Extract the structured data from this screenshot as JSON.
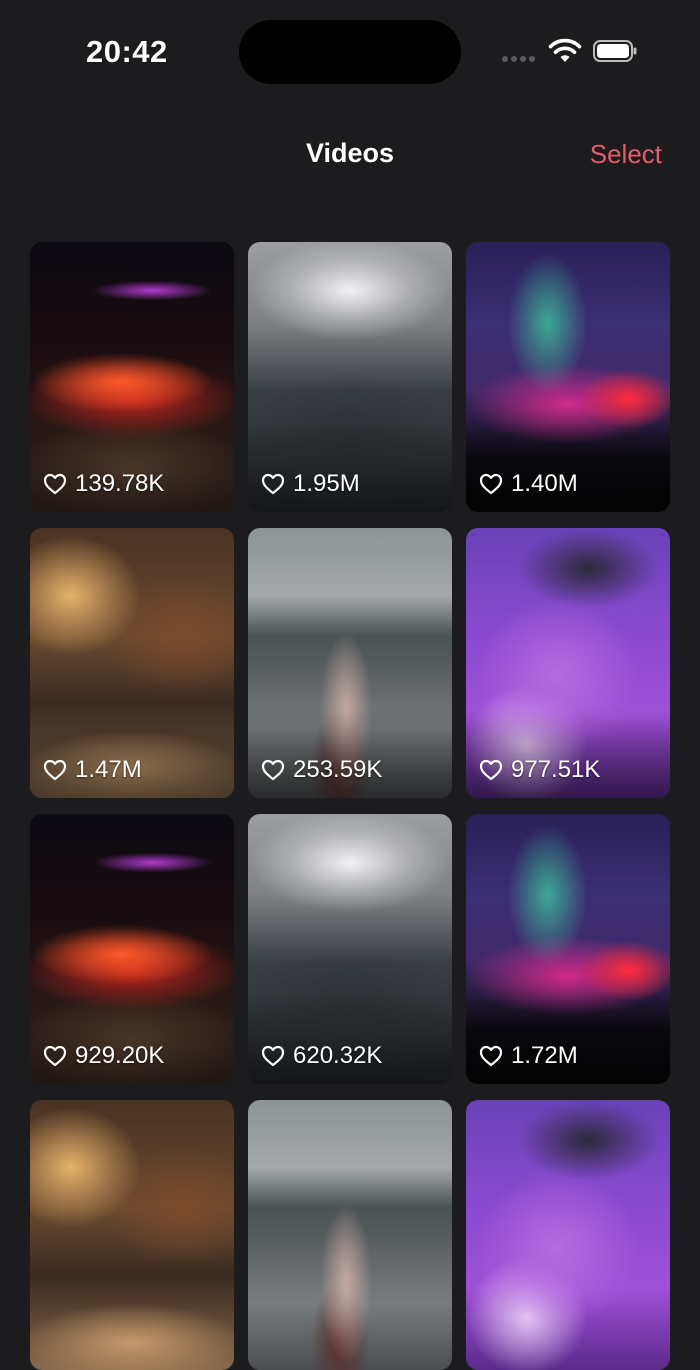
{
  "status_bar": {
    "time": "20:42"
  },
  "nav": {
    "title": "Videos",
    "select_label": "Select"
  },
  "colors": {
    "accent": "#e35d6a",
    "background": "#1c1c1e"
  },
  "videos": [
    {
      "likes": "139.78K",
      "thumbnail": "blurred-concert-crowd"
    },
    {
      "likes": "1.95M",
      "thumbnail": "concert-stage-crowd"
    },
    {
      "likes": "1.40M",
      "thumbnail": "festival-lights-stage"
    },
    {
      "likes": "1.47M",
      "thumbnail": "street-dancing-night"
    },
    {
      "likes": "253.59K",
      "thumbnail": "woman-with-fan-beach"
    },
    {
      "likes": "977.51K",
      "thumbnail": "galaxy-dj-portrait"
    },
    {
      "likes": "929.20K",
      "thumbnail": "blurred-concert-crowd"
    },
    {
      "likes": "620.32K",
      "thumbnail": "concert-stage-crowd"
    },
    {
      "likes": "1.72M",
      "thumbnail": "festival-lights-stage"
    },
    {
      "likes": "",
      "thumbnail": "street-dancing-night"
    },
    {
      "likes": "",
      "thumbnail": "woman-with-fan-beach"
    },
    {
      "likes": "",
      "thumbnail": "galaxy-dj-portrait"
    }
  ]
}
